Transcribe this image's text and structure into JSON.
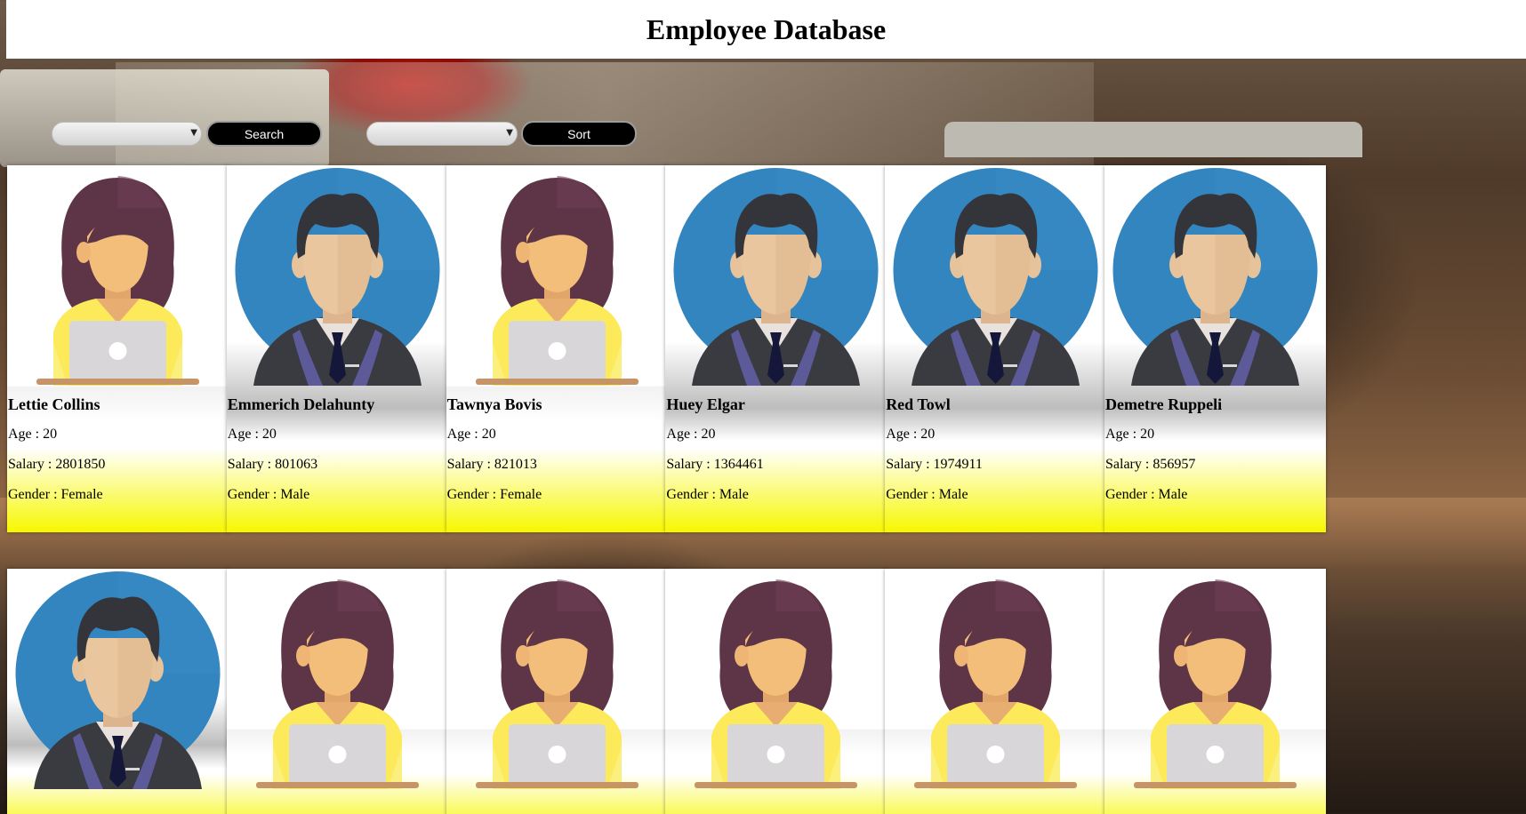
{
  "header": {
    "title": "Employee Database"
  },
  "controls": {
    "search_select_value": "",
    "search_label": "Search",
    "sort_select_value": "",
    "sort_label": "Sort"
  },
  "employees": [
    {
      "name": "Lettie Collins",
      "age": "Age : 20",
      "salary": "Salary : 2801850",
      "gender": "Gender : Female",
      "avatar": "female"
    },
    {
      "name": "Emmerich Delahunty",
      "age": "Age : 20",
      "salary": "Salary : 801063",
      "gender": "Gender : Male",
      "avatar": "male"
    },
    {
      "name": "Tawnya Bovis",
      "age": "Age : 20",
      "salary": "Salary : 821013",
      "gender": "Gender : Female",
      "avatar": "female"
    },
    {
      "name": "Huey Elgar",
      "age": "Age : 20",
      "salary": "Salary : 1364461",
      "gender": "Gender : Male",
      "avatar": "male"
    },
    {
      "name": "Red Towl",
      "age": "Age : 20",
      "salary": "Salary : 1974911",
      "gender": "Gender : Male",
      "avatar": "male"
    },
    {
      "name": "Demetre Ruppeli",
      "age": "Age : 20",
      "salary": "Salary : 856957",
      "gender": "Gender : Male",
      "avatar": "male"
    }
  ],
  "employees_row2": [
    {
      "avatar": "male"
    },
    {
      "avatar": "female"
    },
    {
      "avatar": "female"
    },
    {
      "avatar": "female"
    },
    {
      "avatar": "female"
    },
    {
      "avatar": "female"
    }
  ],
  "colors": {
    "button_bg": "#000000",
    "card_bottom": "#f7f700",
    "male_circle": "#3385bf",
    "female_hair": "#5e3447",
    "female_shirt": "#fdea5a"
  },
  "icons": {
    "male_avatar": "male-avatar-icon",
    "female_avatar": "female-avatar-icon"
  }
}
